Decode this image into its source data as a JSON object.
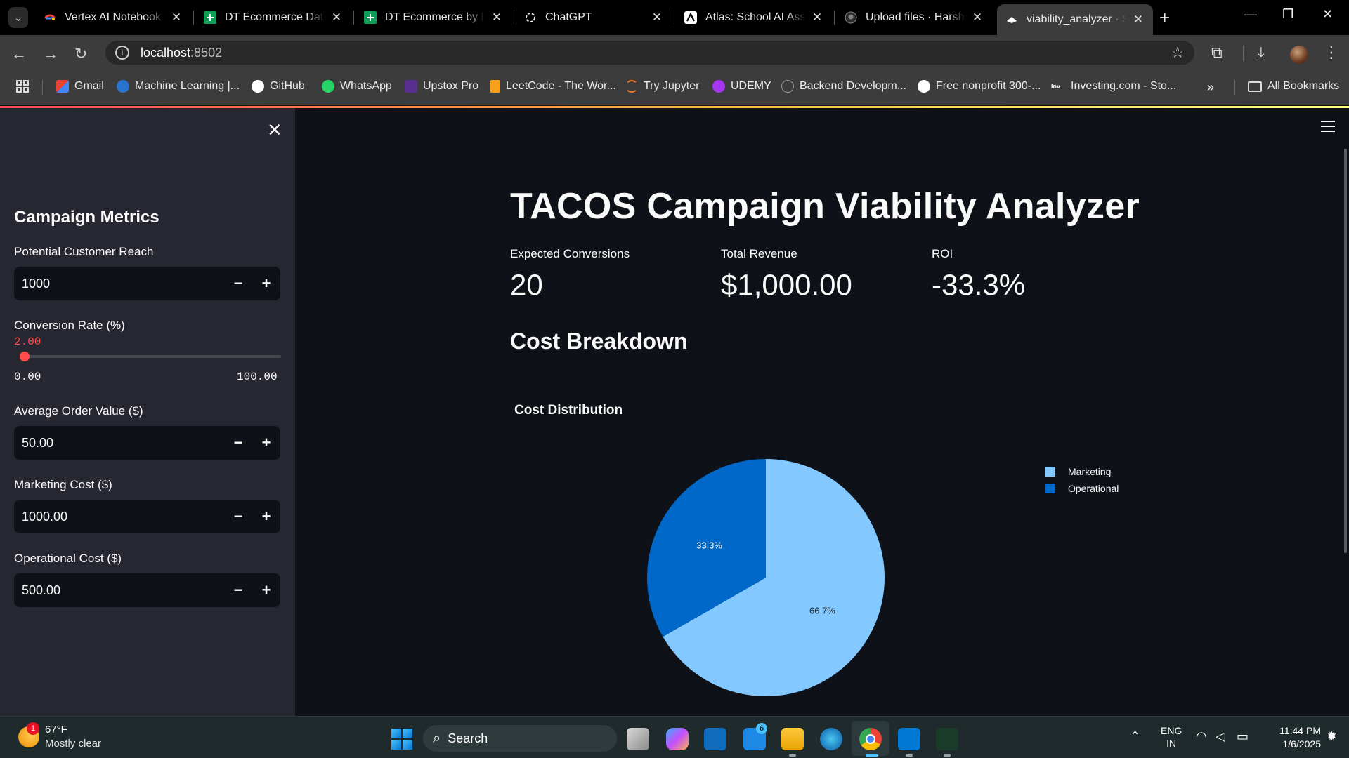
{
  "browser": {
    "tabs": [
      {
        "title": "Vertex AI Notebook S",
        "icon": "google-cloud-icon"
      },
      {
        "title": "DT Ecommerce Data",
        "icon": "google-sheets-icon"
      },
      {
        "title": "DT Ecommerce by Ha",
        "icon": "google-sheets-icon"
      },
      {
        "title": "ChatGPT",
        "icon": "chatgpt-icon"
      },
      {
        "title": "Atlas: School AI Assis",
        "icon": "atlas-icon"
      },
      {
        "title": "Upload files · Harsha",
        "icon": "github-icon"
      },
      {
        "title": "viability_analyzer · St",
        "icon": "streamlit-icon"
      }
    ],
    "url_host": "localhost",
    "url_port": ":8502",
    "bookmarks": [
      {
        "label": "Gmail",
        "icon": "gmail-icon",
        "color": "#ea4335"
      },
      {
        "label": "Machine Learning |...",
        "icon": "coursera-icon",
        "color": "#2a73cc"
      },
      {
        "label": "GitHub",
        "icon": "github-icon",
        "color": "#ffffff"
      },
      {
        "label": "WhatsApp",
        "icon": "whatsapp-icon",
        "color": "#25d366"
      },
      {
        "label": "Upstox Pro",
        "icon": "upstox-icon",
        "color": "#5a2d91"
      },
      {
        "label": "LeetCode - The Wor...",
        "icon": "leetcode-icon",
        "color": "#f89f1b"
      },
      {
        "label": "Try Jupyter",
        "icon": "jupyter-icon",
        "color": "#f37726"
      },
      {
        "label": "UDEMY",
        "icon": "udemy-icon",
        "color": "#a435f0"
      },
      {
        "label": "Backend Developm...",
        "icon": "backend-icon",
        "color": "#777777"
      },
      {
        "label": "Free nonprofit 300-...",
        "icon": "globe-icon",
        "color": "#ffffff"
      },
      {
        "label": "Investing.com - Sto...",
        "icon": "investing-icon",
        "color": "#ffffff"
      }
    ],
    "all_bookmarks_label": "All Bookmarks"
  },
  "sidebar": {
    "title": "Campaign Metrics",
    "reach": {
      "label": "Potential Customer Reach",
      "value": "1000"
    },
    "conversion": {
      "label": "Conversion Rate (%)",
      "value": "2.00",
      "min": "0.00",
      "max": "100.00",
      "fraction": 0.02
    },
    "aov": {
      "label": "Average Order Value ($)",
      "value": "50.00"
    },
    "marketing": {
      "label": "Marketing Cost ($)",
      "value": "1000.00"
    },
    "operational": {
      "label": "Operational Cost ($)",
      "value": "500.00"
    },
    "minus": "−",
    "plus": "+"
  },
  "main": {
    "title": "TACOS Campaign Viability Analyzer",
    "metrics": [
      {
        "label": "Expected Conversions",
        "value": "20"
      },
      {
        "label": "Total Revenue",
        "value": "$1,000.00"
      },
      {
        "label": "ROI",
        "value": "-33.3%"
      }
    ],
    "section": "Cost Breakdown"
  },
  "chart_data": {
    "type": "pie",
    "title": "Cost Distribution",
    "categories": [
      "Marketing",
      "Operational"
    ],
    "values": [
      66.7,
      33.3
    ],
    "labels": [
      "66.7%",
      "33.3%"
    ],
    "colors": [
      "#83c9ff",
      "#0068c9"
    ],
    "label_colors": [
      "#262730",
      "#ffffff"
    ],
    "legend_position": "top-right"
  },
  "taskbar": {
    "weather_temp": "67°F",
    "weather_desc": "Mostly clear",
    "weather_badge": "1",
    "search_placeholder": "Search",
    "outlook_badge": "6",
    "lang_1": "ENG",
    "lang_2": "IN",
    "time": "11:44 PM",
    "date": "1/6/2025"
  }
}
